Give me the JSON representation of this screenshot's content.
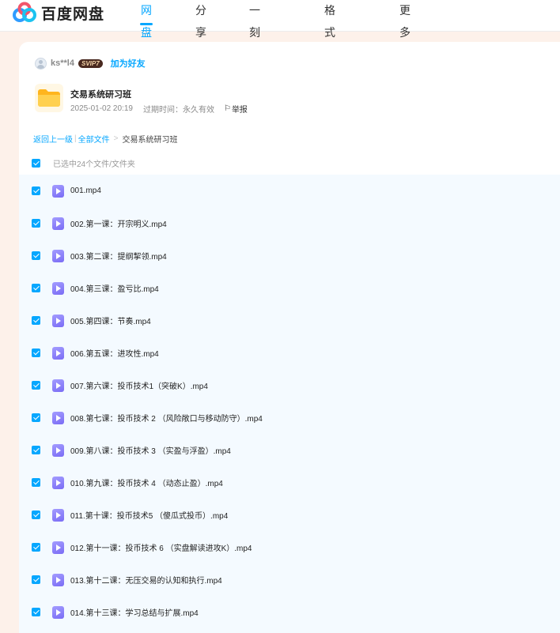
{
  "brand": {
    "name": "百度网盘"
  },
  "nav": [
    {
      "label": "网盘",
      "active": true
    },
    {
      "label": "分享",
      "active": false
    },
    {
      "label": "一刻相册",
      "active": false
    },
    {
      "label": "格式转换",
      "active": false
    },
    {
      "label": "更多",
      "active": false,
      "has_dropdown": true
    }
  ],
  "share": {
    "owner_name": "ks**l4",
    "badge": "SVIP7",
    "add_friend_label": "加为好友",
    "title": "交易系统研习班",
    "date": "2025-01-02 20:19",
    "expire_label": "过期时间：永久有效",
    "report_label": "举报"
  },
  "breadcrumb": {
    "back_label": "返回上一级",
    "all_files_label": "全部文件",
    "separator": "|",
    "arrow": ">",
    "current": "交易系统研习班"
  },
  "selection": {
    "summary": "已选中24个文件/文件夹"
  },
  "files": [
    {
      "name": "001.mp4",
      "checked": true
    },
    {
      "name": "002.第一课：开宗明义.mp4",
      "checked": true
    },
    {
      "name": "003.第二课：提纲挈领.mp4",
      "checked": true
    },
    {
      "name": "004.第三课：盈亏比.mp4",
      "checked": true
    },
    {
      "name": "005.第四课：节奏.mp4",
      "checked": true
    },
    {
      "name": "006.第五课：进攻性.mp4",
      "checked": true
    },
    {
      "name": "007.第六课：投币技术1（突破K）.mp4",
      "checked": true
    },
    {
      "name": "008.第七课：投币技术 2 （风险敞口与移动防守）.mp4",
      "checked": true
    },
    {
      "name": "009.第八课：投币技术 3 （实盈与浮盈）.mp4",
      "checked": true
    },
    {
      "name": "010.第九课：投币技术 4 （动态止盈）.mp4",
      "checked": true
    },
    {
      "name": "011.第十课：投币技术5 （傻瓜式投币）.mp4",
      "checked": true
    },
    {
      "name": "012.第十一课：投币技术 6 （实盘解读进攻K）.mp4",
      "checked": true
    },
    {
      "name": "013.第十二课：无压交易的认知和执行.mp4",
      "checked": true
    },
    {
      "name": "014.第十三课：学习总结与扩展.mp4",
      "checked": true
    }
  ],
  "colors": {
    "accent": "#06a7ff",
    "page_bg": "#fdf1ea",
    "list_bg": "#f4faff"
  },
  "icons": {
    "brand": "baidu-cloud-logo-icon",
    "folder": "folder-icon",
    "video": "video-file-icon",
    "report": "flag-icon"
  }
}
